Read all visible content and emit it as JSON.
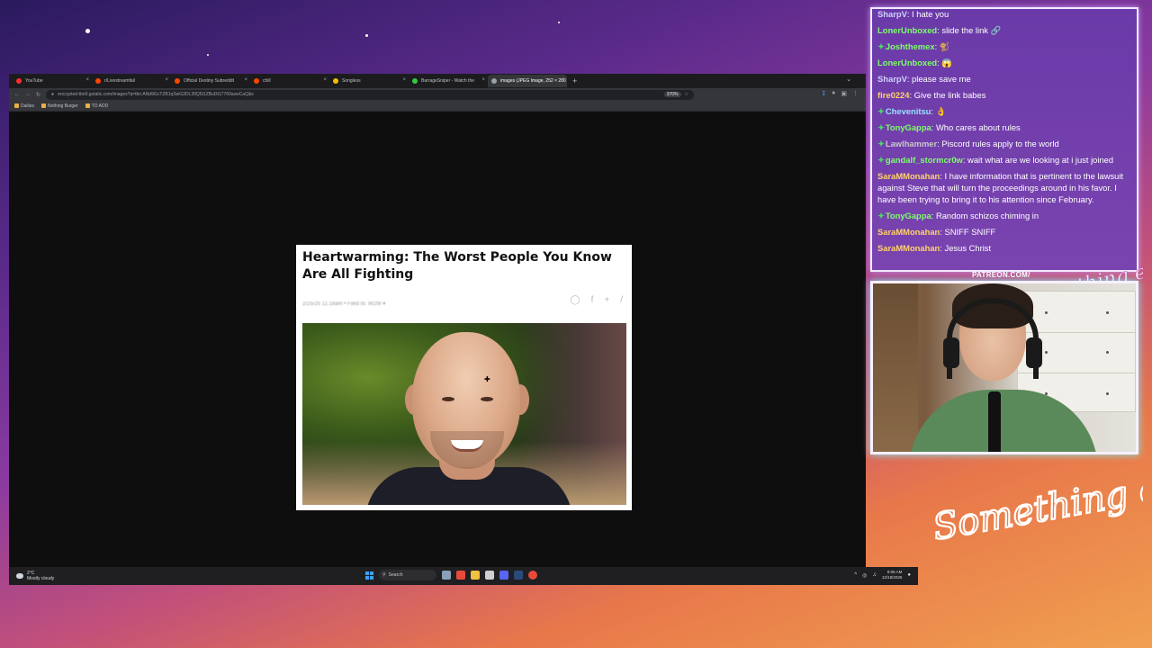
{
  "browser": {
    "tabs": [
      {
        "label": "YouTube",
        "color": "#ff2d2d",
        "active": false
      },
      {
        "label": "r/Livestreamfail",
        "color": "#ff4500",
        "active": false
      },
      {
        "label": "Official Destiny Subreddit",
        "color": "#ff4500",
        "active": false
      },
      {
        "label": "chill",
        "color": "#ff4500",
        "active": false
      },
      {
        "label": "Songless",
        "color": "#f0c000",
        "active": false
      },
      {
        "label": "BarrageSniper - Watch the",
        "color": "#2ecc40",
        "active": false
      },
      {
        "label": "images (JPEG Image, 252 × 200 px)",
        "color": "#9aa0a6",
        "active": true
      }
    ],
    "url": "encrypted-tbn0.gstatic.com/images?q=tbn:ANd9GcTZB1qSwG3DL39Q5t1ZBuDt17760axwCaQ&s",
    "zoom": "370%",
    "bookmarks": [
      {
        "label": "Dailies"
      },
      {
        "label": "Nothing Burger"
      },
      {
        "label": "TO ADD"
      }
    ]
  },
  "card": {
    "title": "Heartwarming: The Worst People You Know Are All Fighting",
    "meta": "2/25/25 11:18am  •  Filed to: W2W ▾"
  },
  "taskbar": {
    "temperature": "2°C",
    "weather": "Mostly cloudy",
    "search_placeholder": "Search",
    "time": "8:06 AM",
    "date": "12/18/2025"
  },
  "chat": {
    "messages": [
      {
        "user": "SharpV",
        "color": "#d0d0ff",
        "text": "I hate you",
        "badge": false
      },
      {
        "user": "LonerUnboxed",
        "color": "#7dff6a",
        "text": "slide the link 🔗",
        "badge": false
      },
      {
        "user": "Joshthemex",
        "color": "#7dff6a",
        "text": "🐒",
        "badge": true
      },
      {
        "user": "LonerUnboxed",
        "color": "#7dff6a",
        "text": "😱",
        "badge": false
      },
      {
        "user": "SharpV",
        "color": "#d0d0ff",
        "text": "please save me",
        "badge": false
      },
      {
        "user": "fire0224",
        "color": "#ffd36a",
        "text": "Give the link babes",
        "badge": false
      },
      {
        "user": "Chevenitsu",
        "color": "#9ae0ff",
        "text": "👌",
        "badge": true
      },
      {
        "user": "TonyGappa",
        "color": "#7dff6a",
        "text": "Who cares about rules",
        "badge": true
      },
      {
        "user": "Lawlhammer",
        "color": "#c9c9c9",
        "text": "Piscord rules apply to the world",
        "badge": true
      },
      {
        "user": "gandalf_stormcr0w",
        "color": "#7dff6a",
        "text": "wait what are we looking at i just joined",
        "badge": true
      },
      {
        "user": "SaraMMonahan",
        "color": "#ffd36a",
        "text": "I have information that is pertinent to the lawsuit against Steve that will turn the proceedings around in his favor. I have been trying to bring it to his attention since February.",
        "badge": false
      },
      {
        "user": "TonyGappa",
        "color": "#7dff6a",
        "text": "Random schizos chiming in",
        "badge": true
      },
      {
        "user": "SaraMMonahan",
        "color": "#ffd36a",
        "text": "SNIFF SNIFF",
        "badge": false
      },
      {
        "user": "SaraMMonahan",
        "color": "#ffd36a",
        "text": "Jesus Christ",
        "badge": false
      }
    ]
  },
  "overlay": {
    "patreon": "PATREON.COM/",
    "brand_top": "Anything else?",
    "brand_bottom": "Something else"
  }
}
